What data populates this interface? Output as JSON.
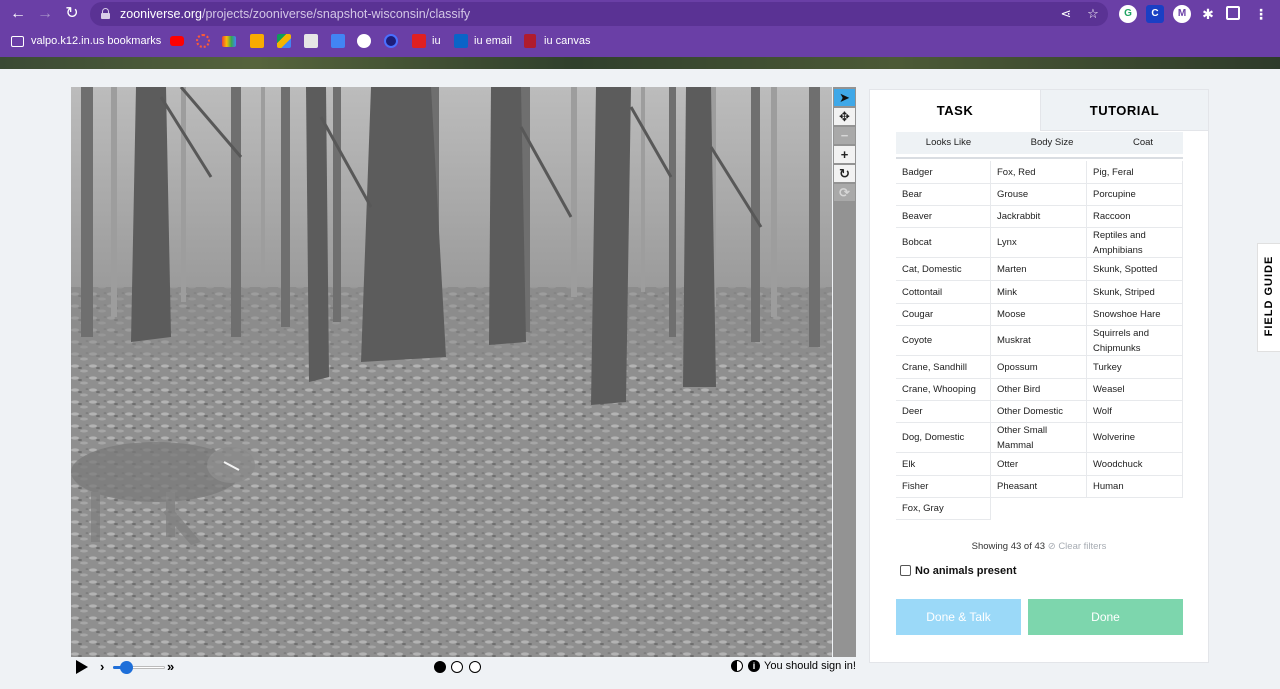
{
  "browser": {
    "url_domain": "zooniverse.org",
    "url_path": "/projects/zooniverse/snapshot-wisconsin/classify",
    "bookmarks": [
      {
        "label": "valpo.k12.in.us bookmarks"
      },
      {
        "label": "iu"
      },
      {
        "label": "iu email"
      },
      {
        "label": "iu canvas"
      }
    ],
    "extensions": [
      "G",
      "C",
      "M"
    ]
  },
  "viewer": {
    "signin_text": "You should sign in!",
    "frame_count": 3,
    "current_frame": 1,
    "playback_speed_fraction": 0.25
  },
  "panel": {
    "tabs": {
      "task": "TASK",
      "tutorial": "TUTORIAL"
    },
    "filters": [
      "Looks Like",
      "Body Size",
      "Coat"
    ],
    "animals": [
      "Badger",
      "Fox, Red",
      "Pig, Feral",
      "Bear",
      "Grouse",
      "Porcupine",
      "Beaver",
      "Jackrabbit",
      "Raccoon",
      "Bobcat",
      "Lynx",
      "Reptiles and Amphibians",
      "Cat, Domestic",
      "Marten",
      "Skunk, Spotted",
      "Cottontail",
      "Mink",
      "Skunk, Striped",
      "Cougar",
      "Moose",
      "Snowshoe Hare",
      "Coyote",
      "Muskrat",
      "Squirrels and Chipmunks",
      "Crane, Sandhill",
      "Opossum",
      "Turkey",
      "Crane, Whooping",
      "Other Bird",
      "Weasel",
      "Deer",
      "Other Domestic",
      "Wolf",
      "Dog, Domestic",
      "Other Small Mammal",
      "Wolverine",
      "Elk",
      "Otter",
      "Woodchuck",
      "Fisher",
      "Pheasant",
      "Human",
      "Fox, Gray"
    ],
    "showing": "Showing 43 of 43",
    "clear_filters": "Clear filters",
    "no_animals": "No animals present",
    "done_talk": "Done & Talk",
    "done": "Done"
  },
  "field_guide": "FIELD GUIDE",
  "colors": {
    "chrome": "#6a3fa6",
    "active_tool": "#3fa8e8",
    "done_talk": "#9bd9f8",
    "done": "#7dd6ad"
  }
}
